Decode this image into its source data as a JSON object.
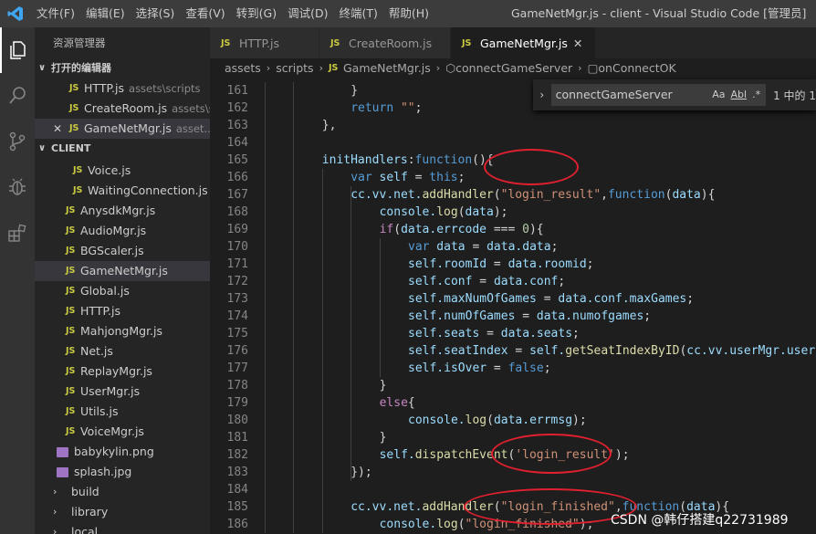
{
  "window": {
    "title": "GameNetMgr.js - client - Visual Studio Code [管理员]",
    "menu": [
      "文件(F)",
      "编辑(E)",
      "选择(S)",
      "查看(V)",
      "转到(G)",
      "调试(D)",
      "终端(T)",
      "帮助(H)"
    ]
  },
  "sidebar": {
    "title": "资源管理器",
    "open_editors_label": "打开的编辑器",
    "open_editors": [
      {
        "name": "HTTP.js",
        "desc": "assets\\scripts"
      },
      {
        "name": "CreateRoom.js",
        "desc": "assets\\scri..."
      },
      {
        "name": "GameNetMgr.js",
        "desc": "asset..."
      }
    ],
    "client_label": "CLIENT",
    "files": [
      {
        "name": "Voice.js",
        "indent": 2
      },
      {
        "name": "WaitingConnection.js",
        "indent": 2
      },
      {
        "name": "AnysdkMgr.js",
        "indent": 1
      },
      {
        "name": "AudioMgr.js",
        "indent": 1
      },
      {
        "name": "BGScaler.js",
        "indent": 1
      },
      {
        "name": "GameNetMgr.js",
        "indent": 1,
        "selected": true
      },
      {
        "name": "Global.js",
        "indent": 1
      },
      {
        "name": "HTTP.js",
        "indent": 1
      },
      {
        "name": "MahjongMgr.js",
        "indent": 1
      },
      {
        "name": "Net.js",
        "indent": 1
      },
      {
        "name": "ReplayMgr.js",
        "indent": 1
      },
      {
        "name": "UserMgr.js",
        "indent": 1
      },
      {
        "name": "Utils.js",
        "indent": 1
      },
      {
        "name": "VoiceMgr.js",
        "indent": 1
      }
    ],
    "images": [
      "babykylin.png",
      "splash.jpg"
    ],
    "folders": [
      "build",
      "library",
      "local"
    ]
  },
  "tabs": [
    {
      "label": "HTTP.js",
      "active": false
    },
    {
      "label": "CreateRoom.js",
      "active": false
    },
    {
      "label": "GameNetMgr.js",
      "active": true
    }
  ],
  "breadcrumbs": [
    "assets",
    "scripts",
    "GameNetMgr.js",
    "connectGameServer",
    "onConnectOK"
  ],
  "find": {
    "value": "connectGameServer",
    "opt_case": "Aa",
    "opt_word": "Abl",
    "opt_regex": ".*",
    "count": "1 中的 1"
  },
  "code": [
    {
      "n": "161",
      "indent": 3,
      "t": [
        [
          "}",
          "#d4d4d4"
        ]
      ]
    },
    {
      "n": "162",
      "indent": 3,
      "t": [
        [
          "return",
          "#569cd6"
        ],
        [
          " ",
          "#d4d4d4"
        ],
        [
          "\"\"",
          "#ce9178"
        ],
        [
          ";",
          "#d4d4d4"
        ]
      ]
    },
    {
      "n": "163",
      "indent": 2,
      "t": [
        [
          "},",
          "#d4d4d4"
        ]
      ]
    },
    {
      "n": "164",
      "indent": 0,
      "t": []
    },
    {
      "n": "165",
      "indent": 2,
      "t": [
        [
          "initHandlers",
          "#9cdcfe"
        ],
        [
          ":",
          "#d4d4d4"
        ],
        [
          "function",
          "#569cd6"
        ],
        [
          "(){",
          "#d4d4d4"
        ]
      ]
    },
    {
      "n": "166",
      "indent": 3,
      "t": [
        [
          "var",
          "#569cd6"
        ],
        [
          " self ",
          "#9cdcfe"
        ],
        [
          "= ",
          "#d4d4d4"
        ],
        [
          "this",
          "#569cd6"
        ],
        [
          ";",
          "#d4d4d4"
        ]
      ]
    },
    {
      "n": "167",
      "indent": 3,
      "t": [
        [
          "cc.vv.net.",
          "#9cdcfe"
        ],
        [
          "addHandler",
          "#dcdcaa"
        ],
        [
          "(",
          "#d4d4d4"
        ],
        [
          "\"login_result\"",
          "#ce9178"
        ],
        [
          ",",
          "#d4d4d4"
        ],
        [
          "function",
          "#569cd6"
        ],
        [
          "(",
          "#d4d4d4"
        ],
        [
          "data",
          "#9cdcfe"
        ],
        [
          "){",
          "#d4d4d4"
        ]
      ]
    },
    {
      "n": "168",
      "indent": 4,
      "t": [
        [
          "console.",
          "#9cdcfe"
        ],
        [
          "log",
          "#dcdcaa"
        ],
        [
          "(",
          "#d4d4d4"
        ],
        [
          "data",
          "#9cdcfe"
        ],
        [
          ");",
          "#d4d4d4"
        ]
      ]
    },
    {
      "n": "169",
      "indent": 4,
      "t": [
        [
          "if",
          "#c586c0"
        ],
        [
          "(",
          "#d4d4d4"
        ],
        [
          "data.errcode",
          "#9cdcfe"
        ],
        [
          " === ",
          "#d4d4d4"
        ],
        [
          "0",
          "#b5cea8"
        ],
        [
          "){",
          "#d4d4d4"
        ]
      ]
    },
    {
      "n": "170",
      "indent": 5,
      "t": [
        [
          "var",
          "#569cd6"
        ],
        [
          " data ",
          "#9cdcfe"
        ],
        [
          "= ",
          "#d4d4d4"
        ],
        [
          "data.data",
          "#9cdcfe"
        ],
        [
          ";",
          "#d4d4d4"
        ]
      ]
    },
    {
      "n": "171",
      "indent": 5,
      "t": [
        [
          "self.roomId",
          "#9cdcfe"
        ],
        [
          " = ",
          "#d4d4d4"
        ],
        [
          "data.roomid",
          "#9cdcfe"
        ],
        [
          ";",
          "#d4d4d4"
        ]
      ]
    },
    {
      "n": "172",
      "indent": 5,
      "t": [
        [
          "self.conf",
          "#9cdcfe"
        ],
        [
          " = ",
          "#d4d4d4"
        ],
        [
          "data.conf",
          "#9cdcfe"
        ],
        [
          ";",
          "#d4d4d4"
        ]
      ]
    },
    {
      "n": "173",
      "indent": 5,
      "t": [
        [
          "self.maxNumOfGames",
          "#9cdcfe"
        ],
        [
          " = ",
          "#d4d4d4"
        ],
        [
          "data.conf.maxGames",
          "#9cdcfe"
        ],
        [
          ";",
          "#d4d4d4"
        ]
      ]
    },
    {
      "n": "174",
      "indent": 5,
      "t": [
        [
          "self.numOfGames",
          "#9cdcfe"
        ],
        [
          " = ",
          "#d4d4d4"
        ],
        [
          "data.numofgames",
          "#9cdcfe"
        ],
        [
          ";",
          "#d4d4d4"
        ]
      ]
    },
    {
      "n": "175",
      "indent": 5,
      "t": [
        [
          "self.seats",
          "#9cdcfe"
        ],
        [
          " = ",
          "#d4d4d4"
        ],
        [
          "data.seats",
          "#9cdcfe"
        ],
        [
          ";",
          "#d4d4d4"
        ]
      ]
    },
    {
      "n": "176",
      "indent": 5,
      "t": [
        [
          "self.seatIndex",
          "#9cdcfe"
        ],
        [
          " = ",
          "#d4d4d4"
        ],
        [
          "self.",
          "#9cdcfe"
        ],
        [
          "getSeatIndexByID",
          "#dcdcaa"
        ],
        [
          "(",
          "#d4d4d4"
        ],
        [
          "cc.vv.userMgr.userId",
          "#9cdcfe"
        ],
        [
          ");",
          "#d4d4d4"
        ]
      ]
    },
    {
      "n": "177",
      "indent": 5,
      "t": [
        [
          "self.isOver",
          "#9cdcfe"
        ],
        [
          " = ",
          "#d4d4d4"
        ],
        [
          "false",
          "#569cd6"
        ],
        [
          ";",
          "#d4d4d4"
        ]
      ]
    },
    {
      "n": "178",
      "indent": 4,
      "t": [
        [
          "}",
          "#d4d4d4"
        ]
      ]
    },
    {
      "n": "179",
      "indent": 4,
      "t": [
        [
          "else",
          "#c586c0"
        ],
        [
          "{",
          "#d4d4d4"
        ]
      ]
    },
    {
      "n": "180",
      "indent": 5,
      "t": [
        [
          "console.",
          "#9cdcfe"
        ],
        [
          "log",
          "#dcdcaa"
        ],
        [
          "(",
          "#d4d4d4"
        ],
        [
          "data.errmsg",
          "#9cdcfe"
        ],
        [
          ");",
          "#d4d4d4"
        ]
      ]
    },
    {
      "n": "181",
      "indent": 4,
      "t": [
        [
          "}",
          "#d4d4d4"
        ]
      ]
    },
    {
      "n": "182",
      "indent": 4,
      "t": [
        [
          "self.",
          "#9cdcfe"
        ],
        [
          "dispatchEvent",
          "#dcdcaa"
        ],
        [
          "(",
          "#d4d4d4"
        ],
        [
          "'login_result'",
          "#ce9178"
        ],
        [
          ");",
          "#d4d4d4"
        ]
      ]
    },
    {
      "n": "183",
      "indent": 3,
      "t": [
        [
          "});",
          "#d4d4d4"
        ]
      ]
    },
    {
      "n": "184",
      "indent": 0,
      "t": []
    },
    {
      "n": "185",
      "indent": 3,
      "t": [
        [
          "cc.vv.net.",
          "#9cdcfe"
        ],
        [
          "addHandler",
          "#dcdcaa"
        ],
        [
          "(",
          "#d4d4d4"
        ],
        [
          "\"login_finished\"",
          "#ce9178"
        ],
        [
          ",",
          "#d4d4d4"
        ],
        [
          "function",
          "#569cd6"
        ],
        [
          "(",
          "#d4d4d4"
        ],
        [
          "data",
          "#9cdcfe"
        ],
        [
          "){",
          "#d4d4d4"
        ]
      ]
    },
    {
      "n": "186",
      "indent": 4,
      "t": [
        [
          "console.",
          "#9cdcfe"
        ],
        [
          "log",
          "#dcdcaa"
        ],
        [
          "(",
          "#d4d4d4"
        ],
        [
          "\"login_finished\"",
          "#ce9178"
        ],
        [
          ");",
          "#d4d4d4"
        ]
      ]
    }
  ],
  "watermark": "CSDN @韩仔搭建q22731989"
}
